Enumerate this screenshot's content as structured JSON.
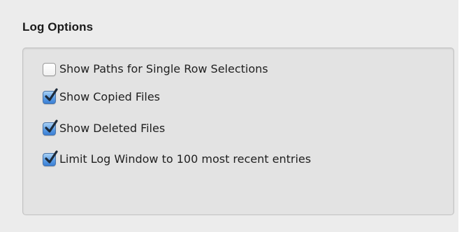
{
  "log_options": {
    "title": "Log Options",
    "options": [
      {
        "label": "Show Paths for Single Row Selections",
        "checked": false
      },
      {
        "label": "Show Copied Files",
        "checked": true
      },
      {
        "label": "Show Deleted Files",
        "checked": true
      },
      {
        "label": "Limit Log Window to 100 most recent entries",
        "checked": true
      }
    ]
  },
  "colors": {
    "background": "#ececec",
    "group_box": "#e3e3e3",
    "check_accent": "#3b7fd4"
  },
  "icons": {
    "checkbox_checked": "checkmark-icon"
  }
}
